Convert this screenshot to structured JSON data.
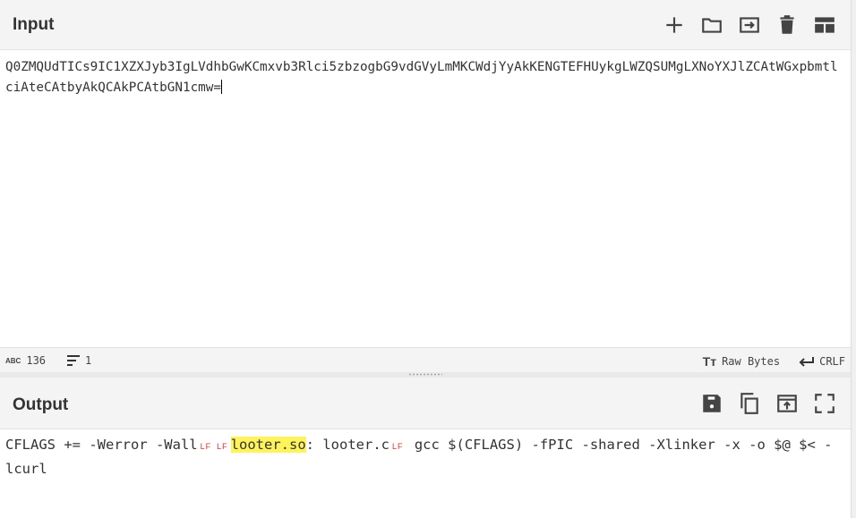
{
  "input": {
    "title": "Input",
    "text": "Q0ZMQUdTICs9IC1XZXJyb3IgLVdhbGwKCmxvb3Rlci5zbzogbG9vdGVyLmMKCWdjYyAkKENGTEFHUykgLWZQSUMgLXNoYXJlZCAtWGxpbmtlciAteCAtbyAkQCAkPCAtbGN1cmw=",
    "toolbar": [
      "add-icon",
      "open-folder-icon",
      "import-icon",
      "trash-icon",
      "layout-icon"
    ]
  },
  "status": {
    "chars": "136",
    "lines": "1",
    "encoding": "Raw Bytes",
    "eol": "CRLF"
  },
  "output": {
    "title": "Output",
    "seg1": "CFLAGS += -Werror -Wall",
    "lf1": "LF",
    "lf2": "LF",
    "highlight": "looter.so",
    "seg2": ": looter.c",
    "lf3": "LF",
    "seg3": " gcc $(CFLAGS) -fPIC -shared -Xlinker -x -o $@ $< -lcurl",
    "toolbar": [
      "save-icon",
      "copy-icon",
      "replace-input-icon",
      "maximize-icon"
    ]
  },
  "colors": {
    "highlight": "#fff35c",
    "lf_marker": "#e0312b",
    "header_bg": "#f4f4f4"
  }
}
